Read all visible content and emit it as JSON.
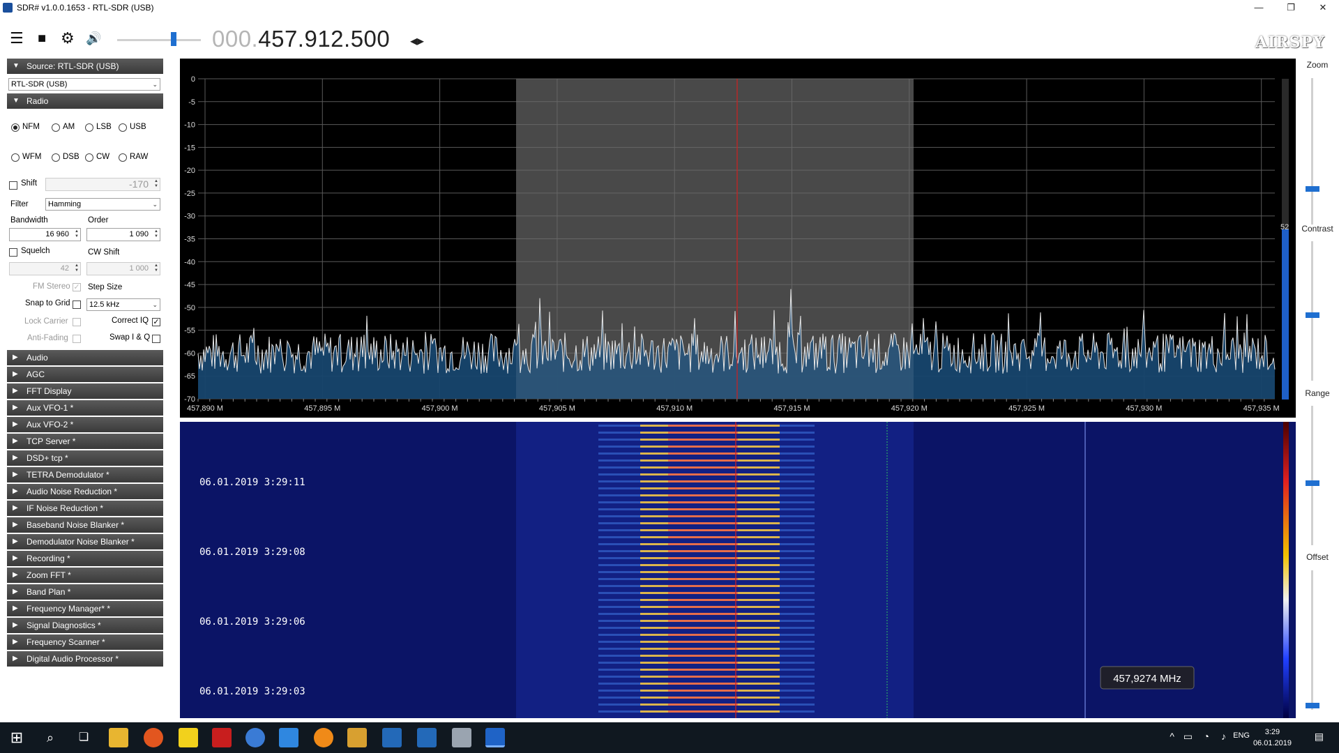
{
  "window": {
    "title": "SDR# v1.0.0.1653 - RTL-SDR (USB)",
    "min": "—",
    "restore": "❐",
    "close": "✕"
  },
  "toolbar": {
    "menu_icon": "☰",
    "stop_icon": "■",
    "settings_icon": "⚙",
    "audio_icon": "🔊",
    "freq_dim": "000.",
    "freq_main": "457.912.500",
    "freq_arrows": "◂▸",
    "logo": "AIRSPY"
  },
  "source": {
    "header": "Source: RTL-SDR (USB)",
    "device": "RTL-SDR (USB)"
  },
  "radio": {
    "header": "Radio",
    "modes": [
      "NFM",
      "AM",
      "LSB",
      "USB",
      "WFM",
      "DSB",
      "CW",
      "RAW"
    ],
    "selected_mode": "NFM",
    "shift_label": "Shift",
    "shift_value": "-170",
    "filter_label": "Filter",
    "filter_value": "Hamming",
    "bandwidth_label": "Bandwidth",
    "bandwidth_value": "16 960",
    "order_label": "Order",
    "order_value": "1 090",
    "squelch_label": "Squelch",
    "squelch_value": "42",
    "cwshift_label": "CW Shift",
    "cwshift_value": "1 000",
    "fmstereo_label": "FM Stereo",
    "stepsize_label": "Step Size",
    "snap_label": "Snap to Grid",
    "step_value": "12.5 kHz",
    "lockcarrier_label": "Lock Carrier",
    "correctiq_label": "Correct IQ",
    "antifading_label": "Anti-Fading",
    "swapiq_label": "Swap I & Q"
  },
  "plugins": [
    "Audio",
    "AGC",
    "FFT Display",
    "Aux VFO-1 *",
    "Aux VFO-2 *",
    "TCP Server *",
    "DSD+ tcp *",
    "TETRA Demodulator *",
    "Audio Noise Reduction *",
    "IF Noise Reduction *",
    "Baseband Noise Blanker *",
    "Demodulator Noise Blanker *",
    "Recording *",
    "Zoom FFT *",
    "Band Plan *",
    "Frequency Manager* *",
    "Signal Diagnostics *",
    "Frequency Scanner *",
    "Digital Audio Processor *"
  ],
  "spectrum": {
    "db_ticks": [
      "0",
      "-5",
      "-10",
      "-15",
      "-20",
      "-25",
      "-30",
      "-35",
      "-40",
      "-45",
      "-50",
      "-55",
      "-60",
      "-65",
      "-70"
    ],
    "freq_ticks": [
      "457,890 M",
      "457,895 M",
      "457,900 M",
      "457,905 M",
      "457,910 M",
      "457,915 M",
      "457,920 M",
      "457,925 M",
      "457,930 M",
      "457,935 M"
    ],
    "level_value": "52",
    "colors": {
      "fill": "#17466e",
      "trace": "#e8e8e8",
      "marker": "#d02020",
      "band": "#3a3a3a"
    }
  },
  "waterfall": {
    "timestamps": [
      "06.01.2019 3:29:11",
      "06.01.2019 3:29:08",
      "06.01.2019 3:29:06",
      "06.01.2019 3:29:03"
    ],
    "tooltip": "457,9274 MHz"
  },
  "right_panel": {
    "zoom": "Zoom",
    "contrast": "Contrast",
    "range": "Range",
    "offset": "Offset"
  },
  "taskbar": {
    "lang": "ENG",
    "time": "3:29",
    "date": "06.01.2019"
  }
}
